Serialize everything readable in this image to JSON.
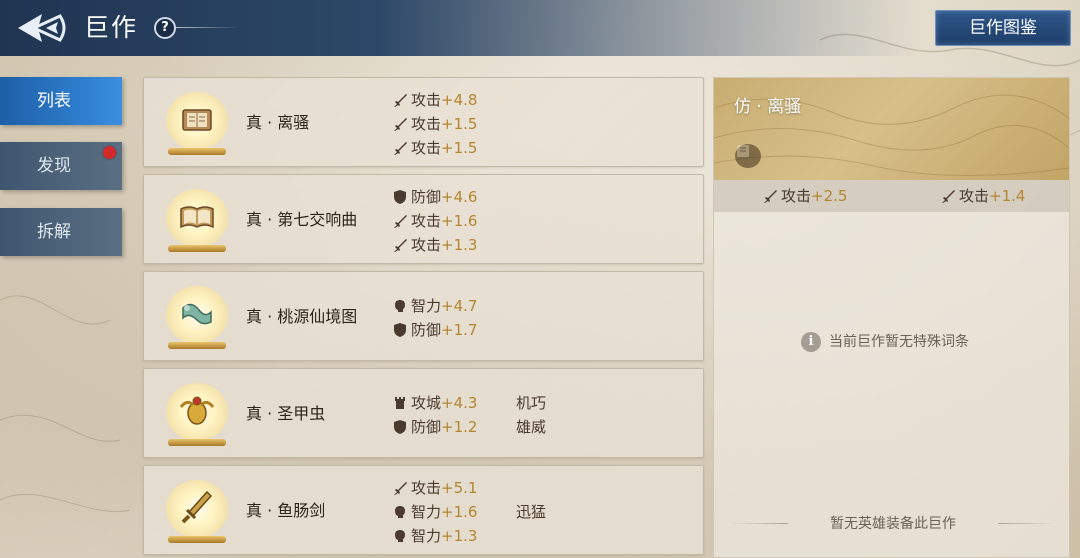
{
  "header": {
    "title": "巨作",
    "help_label": "?",
    "gallery_button": "巨作图鉴"
  },
  "nav": {
    "tabs": [
      {
        "label": "列表",
        "active": true,
        "badge": false
      },
      {
        "label": "发现",
        "active": false,
        "badge": true
      },
      {
        "label": "拆解",
        "active": false,
        "badge": false
      }
    ]
  },
  "items": [
    {
      "name": "真 · 离骚",
      "icon": "scroll-book-icon",
      "stats": [
        {
          "icon": "sword-icon",
          "label": "攻击",
          "value": "+4.8"
        },
        {
          "icon": "sword-icon",
          "label": "攻击",
          "value": "+1.5"
        },
        {
          "icon": "sword-icon",
          "label": "攻击",
          "value": "+1.5"
        }
      ],
      "traits": []
    },
    {
      "name": "真 · 第七交响曲",
      "icon": "open-book-icon",
      "stats": [
        {
          "icon": "shield-icon",
          "label": "防御",
          "value": "+4.6"
        },
        {
          "icon": "sword-icon",
          "label": "攻击",
          "value": "+1.6"
        },
        {
          "icon": "sword-icon",
          "label": "攻击",
          "value": "+1.3"
        }
      ],
      "traits": []
    },
    {
      "name": "真 · 桃源仙境图",
      "icon": "painting-icon",
      "stats": [
        {
          "icon": "brain-icon",
          "label": "智力",
          "value": "+4.7"
        },
        {
          "icon": "shield-icon",
          "label": "防御",
          "value": "+1.7"
        }
      ],
      "traits": []
    },
    {
      "name": "真 · 圣甲虫",
      "icon": "scarab-icon",
      "stats": [
        {
          "icon": "tower-icon",
          "label": "攻城",
          "value": "+4.3"
        },
        {
          "icon": "shield-icon",
          "label": "防御",
          "value": "+1.2"
        }
      ],
      "traits": [
        "机巧",
        "雄威"
      ]
    },
    {
      "name": "真 · 鱼肠剑",
      "icon": "dagger-icon",
      "stats": [
        {
          "icon": "sword-icon",
          "label": "攻击",
          "value": "+5.1"
        },
        {
          "icon": "brain-icon",
          "label": "智力",
          "value": "+1.6"
        },
        {
          "icon": "brain-icon",
          "label": "智力",
          "value": "+1.3"
        }
      ],
      "traits": [
        "",
        "迅猛"
      ]
    }
  ],
  "detail": {
    "title": "仿 · 离骚",
    "book_icon": "book-icon",
    "stats": [
      {
        "icon": "sword-icon",
        "label": "攻击",
        "value": "+2.5"
      },
      {
        "icon": "sword-icon",
        "label": "攻击",
        "value": "+1.4"
      }
    ],
    "empty_note": "当前巨作暂无特殊词条",
    "info_icon": "i",
    "no_hero_note": "暂无英雄装备此巨作"
  },
  "colors": {
    "accent_blue": "#2f7fd0",
    "header_blue": "#1f3552",
    "stat_gold": "#b5852f",
    "badge_red": "#d42a2a"
  }
}
